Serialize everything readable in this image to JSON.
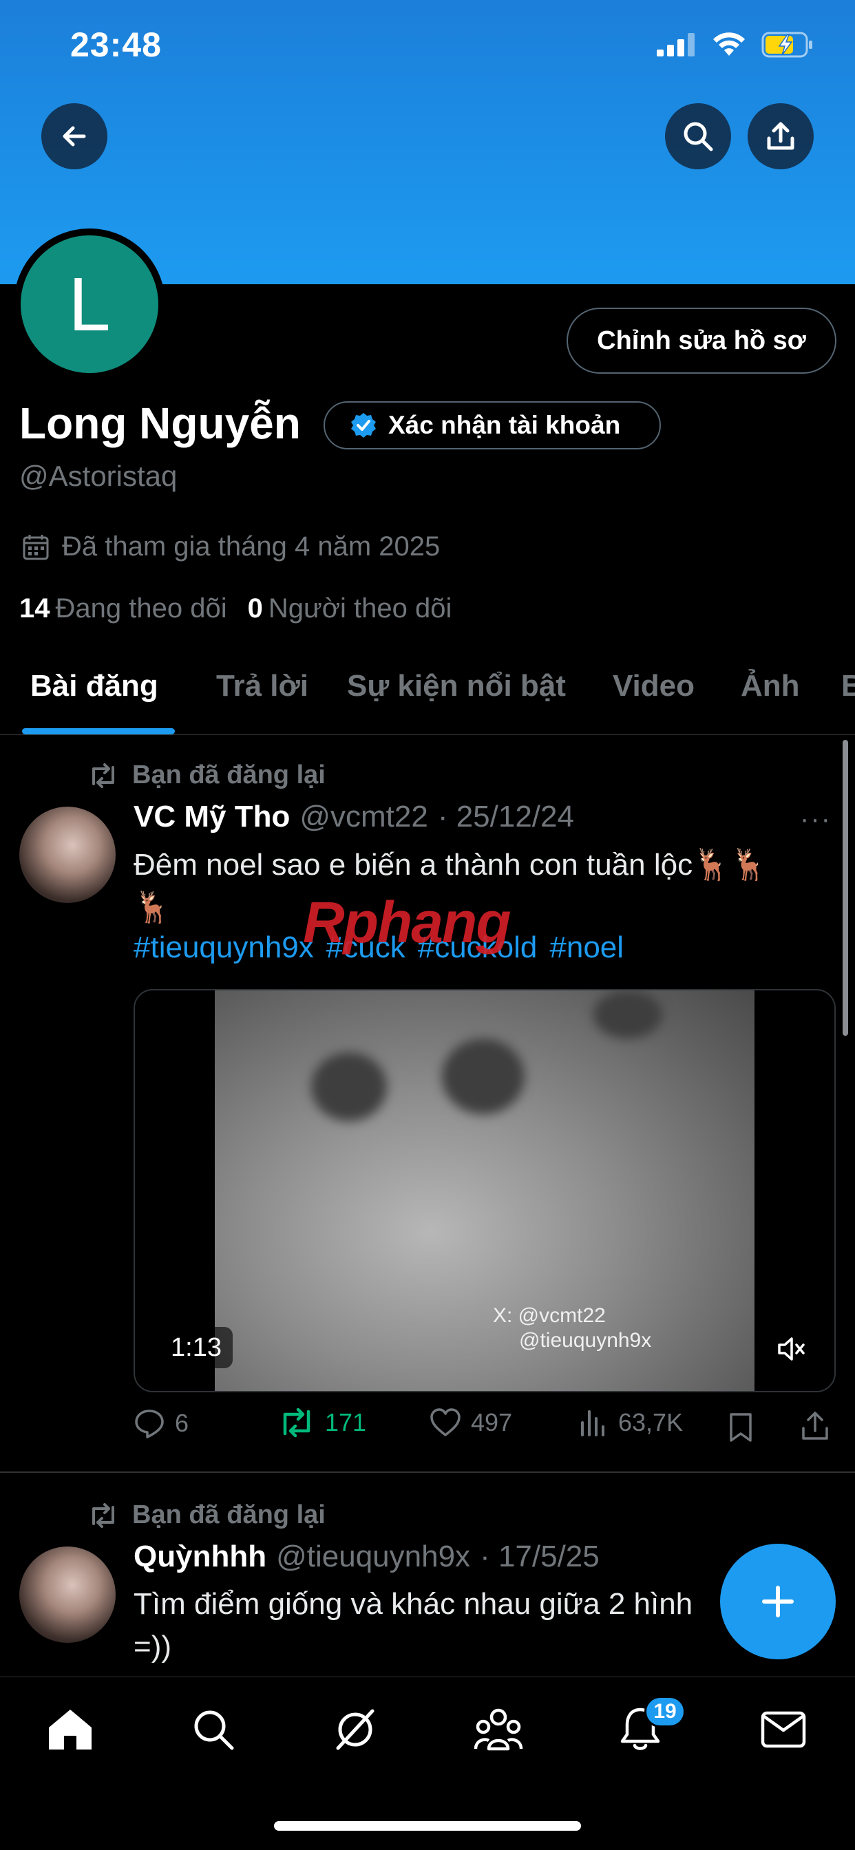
{
  "status_bar": {
    "time": "23:48"
  },
  "profile": {
    "avatar_letter": "L",
    "edit_profile_label": "Chỉnh sửa hồ sơ",
    "name": "Long Nguyễn",
    "verify_label": "Xác nhận tài khoản",
    "handle": "@Astoristaq",
    "joined": "Đã tham gia tháng 4 năm 2025",
    "following_count": "14",
    "following_label": "Đang theo dõi",
    "followers_count": "0",
    "followers_label": "Người theo dõi"
  },
  "tabs": [
    {
      "label": "Bài đăng"
    },
    {
      "label": "Trả lời"
    },
    {
      "label": "Sự kiện nổi bật"
    },
    {
      "label": "Video"
    },
    {
      "label": "Ảnh"
    },
    {
      "label": "B"
    }
  ],
  "watermark_logo": "Rphang",
  "posts": [
    {
      "repost_label": "Bạn đã đăng lại",
      "author_name": "VC Mỹ Tho",
      "author_handle": "@vcmt22",
      "date": "· 25/12/24",
      "more": "···",
      "text_line1": "Đêm noel sao e biến a thành con tuần lộc🦌🦌",
      "text_line2": "🦌",
      "hashtags": [
        "#tieuquynh9x",
        "#cuck",
        "#cuckold",
        "#noel"
      ],
      "video": {
        "duration": "1:13",
        "watermark_line1": "X: @vcmt22",
        "watermark_line2": "@tieuquynh9x"
      },
      "stats": {
        "replies": "6",
        "reposts": "171",
        "likes": "497",
        "views": "63,7K"
      }
    },
    {
      "repost_label": "Bạn đã đăng lại",
      "author_name": "Quỳnhhh",
      "author_handle": "@tieuquynh9x",
      "date": "· 17/5/25",
      "text_line1": "Tìm điểm giống và khác nhau giữa 2 hình",
      "text_line2": "=))"
    }
  ],
  "bottom_nav": {
    "notifications_badge": "19"
  },
  "colors": {
    "accent": "#1d9bf0",
    "repost_green": "#00ba7c",
    "muted": "#71767b"
  }
}
